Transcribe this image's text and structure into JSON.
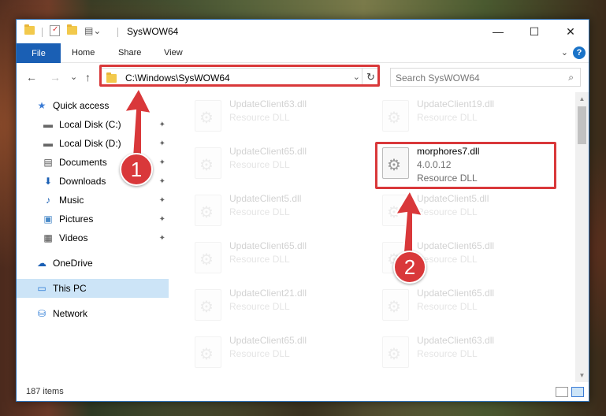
{
  "window": {
    "title": "SysWOW64",
    "controls": {
      "minimize": "—",
      "maximize": "☐",
      "close": "✕"
    }
  },
  "ribbon": {
    "tabs": [
      "File",
      "Home",
      "Share",
      "View"
    ],
    "help": "?",
    "chevron": "⌄"
  },
  "nav": {
    "back": "←",
    "forward": "→",
    "recent": "⌄",
    "up": "↑",
    "address": "C:\\Windows\\SysWOW64",
    "address_dropdown": "⌄",
    "refresh": "↻",
    "search_placeholder": "Search SysWOW64",
    "search_icon": "⌕"
  },
  "sidebar": {
    "items": [
      {
        "label": "Quick access",
        "icon": "star-icon",
        "glyph": "★",
        "pinned": false
      },
      {
        "label": "Local Disk (C:)",
        "icon": "drive-icon",
        "glyph": "▬",
        "pinned": true
      },
      {
        "label": "Local Disk (D:)",
        "icon": "drive-icon",
        "glyph": "▬",
        "pinned": true
      },
      {
        "label": "Documents",
        "icon": "documents-icon",
        "glyph": "▤",
        "pinned": true
      },
      {
        "label": "Downloads",
        "icon": "downloads-icon",
        "glyph": "⬇",
        "pinned": true
      },
      {
        "label": "Music",
        "icon": "music-icon",
        "glyph": "♪",
        "pinned": true
      },
      {
        "label": "Pictures",
        "icon": "pictures-icon",
        "glyph": "▣",
        "pinned": true
      },
      {
        "label": "Videos",
        "icon": "videos-icon",
        "glyph": "▦",
        "pinned": true
      },
      {
        "label": "OneDrive",
        "icon": "cloud-icon",
        "glyph": "☁",
        "pinned": false
      },
      {
        "label": "This PC",
        "icon": "computer-icon",
        "glyph": "▭",
        "pinned": false
      },
      {
        "label": "Network",
        "icon": "network-icon",
        "glyph": "⛁",
        "pinned": false
      }
    ],
    "pin_glyph": "📌"
  },
  "files": [
    {
      "name": "UpdateClient63.dll",
      "type": "Resource DLL",
      "version": "",
      "highlighted": false
    },
    {
      "name": "UpdateClient19.dll",
      "type": "Resource DLL",
      "version": "",
      "highlighted": false
    },
    {
      "name": "UpdateClient65.dll",
      "type": "Resource DLL",
      "version": "",
      "highlighted": false
    },
    {
      "name": "morphores7.dll",
      "type": "Resource DLL",
      "version": "4.0.0.12",
      "highlighted": true
    },
    {
      "name": "UpdateClient5.dll",
      "type": "Resource DLL",
      "version": "",
      "highlighted": false
    },
    {
      "name": "UpdateClient5.dll",
      "type": "Resource DLL",
      "version": "",
      "highlighted": false
    },
    {
      "name": "UpdateClient65.dll",
      "type": "Resource DLL",
      "version": "",
      "highlighted": false
    },
    {
      "name": "UpdateClient65.dll",
      "type": "Resource DLL",
      "version": "",
      "highlighted": false
    },
    {
      "name": "UpdateClient21.dll",
      "type": "Resource DLL",
      "version": "",
      "highlighted": false
    },
    {
      "name": "UpdateClient65.dll",
      "type": "Resource DLL",
      "version": "",
      "highlighted": false
    },
    {
      "name": "UpdateClient65.dll",
      "type": "Resource DLL",
      "version": "",
      "highlighted": false
    },
    {
      "name": "UpdateClient63.dll",
      "type": "Resource DLL",
      "version": "",
      "highlighted": false
    }
  ],
  "status": {
    "item_count": "187 items"
  },
  "callouts": {
    "one": "1",
    "two": "2"
  },
  "colors": {
    "accent": "#1a5fb4",
    "annotation": "#d9383a",
    "selected": "#cce4f7"
  }
}
